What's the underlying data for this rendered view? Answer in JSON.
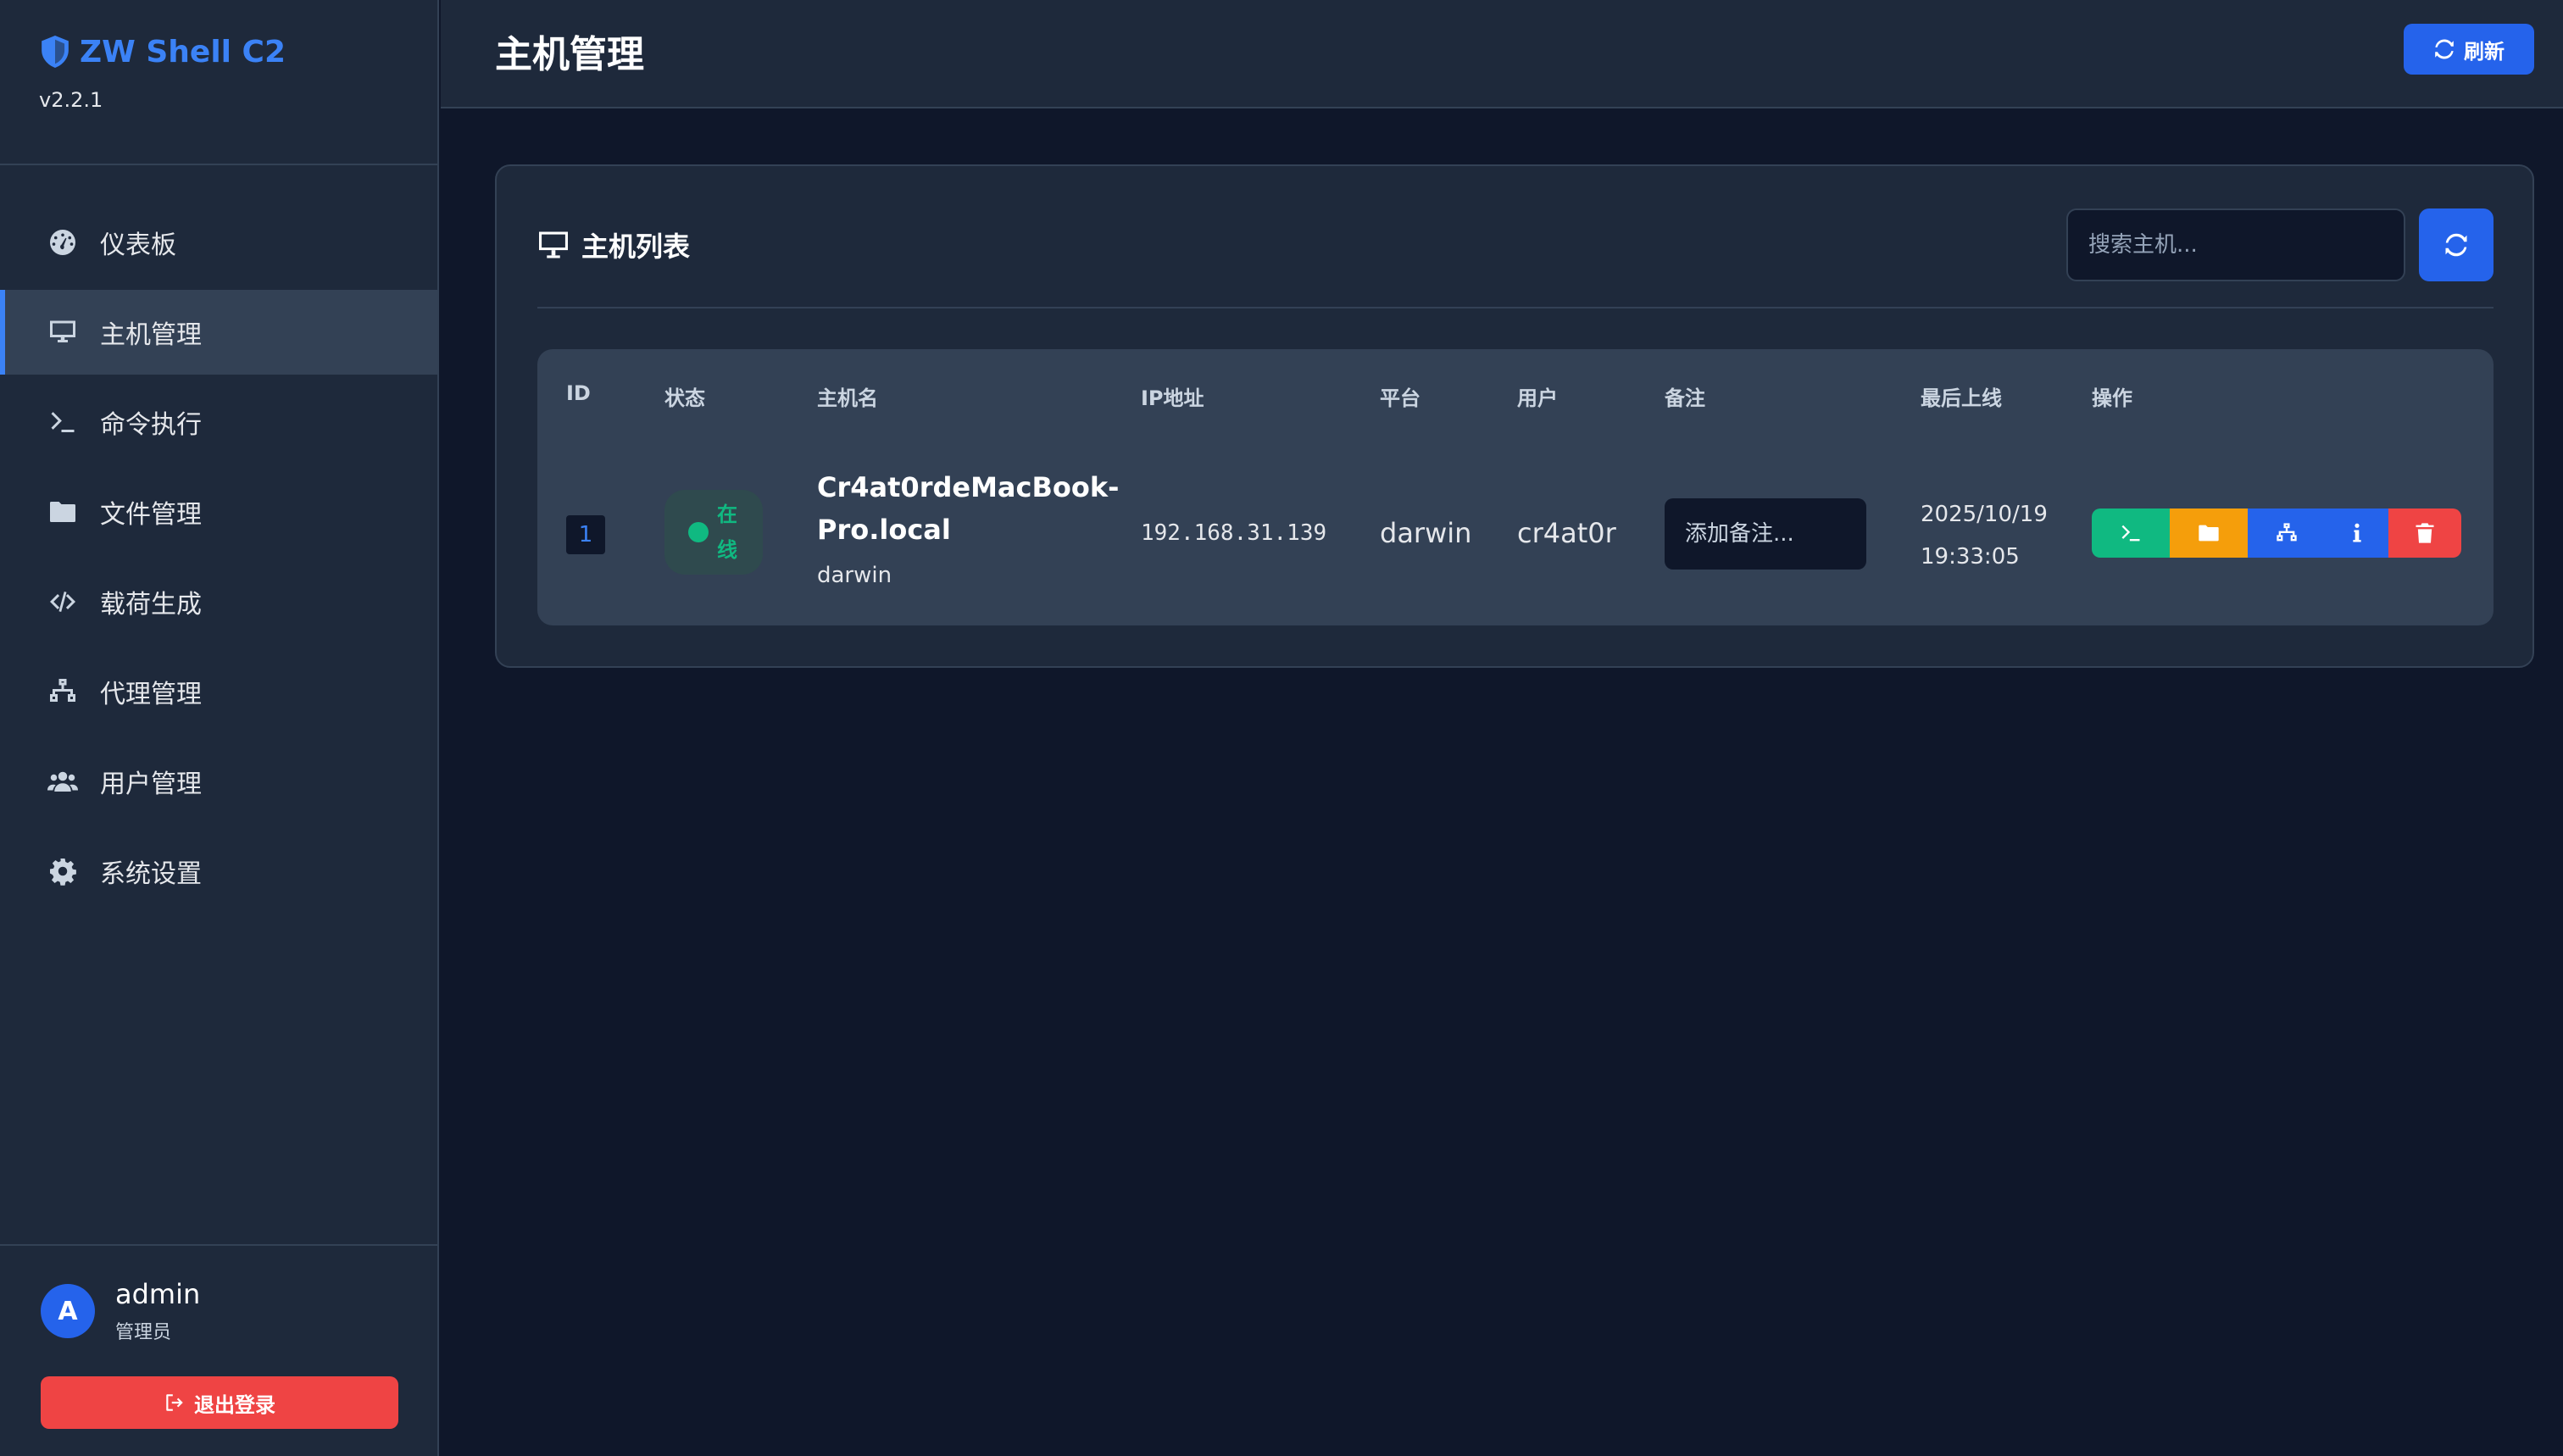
{
  "brand": {
    "title": "ZW Shell C2",
    "version": "v2.2.1"
  },
  "sidebar": {
    "items": [
      {
        "label": "仪表板",
        "icon": "dashboard-icon"
      },
      {
        "label": "主机管理",
        "icon": "desktop-icon",
        "active": true
      },
      {
        "label": "命令执行",
        "icon": "terminal-icon"
      },
      {
        "label": "文件管理",
        "icon": "folder-icon"
      },
      {
        "label": "载荷生成",
        "icon": "code-icon"
      },
      {
        "label": "代理管理",
        "icon": "network-icon"
      },
      {
        "label": "用户管理",
        "icon": "users-icon"
      },
      {
        "label": "系统设置",
        "icon": "gear-icon"
      }
    ]
  },
  "user": {
    "avatar_letter": "A",
    "name": "admin",
    "role": "管理员"
  },
  "logout_label": "退出登录",
  "header": {
    "title": "主机管理",
    "refresh_label": "刷新"
  },
  "card": {
    "title": "主机列表",
    "search_placeholder": "搜索主机..."
  },
  "table": {
    "columns": [
      "ID",
      "状态",
      "主机名",
      "IP地址",
      "平台",
      "用户",
      "备注",
      "最后上线",
      "操作"
    ],
    "rows": [
      {
        "id": "1",
        "status": "在线",
        "hostname": "Cr4at0rdeMacBook-Pro.local",
        "host_os": "darwin",
        "ip": "192.168.31.139",
        "platform": "darwin",
        "user": "cr4at0r",
        "note_placeholder": "添加备注...",
        "last_seen_date": "2025/10/19",
        "last_seen_time": "19:33:05"
      }
    ]
  },
  "colors": {
    "accent": "#2563eb",
    "online": "#10b981",
    "warning": "#f59e0b",
    "danger": "#ef4444",
    "background": "#0f172a",
    "panel": "#1e293b"
  }
}
